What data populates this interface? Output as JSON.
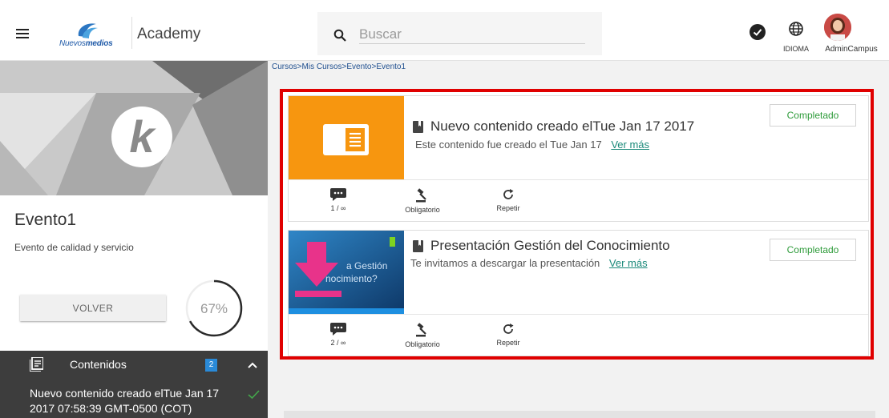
{
  "header": {
    "logo_text_italic": "Nuevos",
    "logo_text_bold": "medios",
    "brand_title": "Academy",
    "search_placeholder": "Buscar",
    "language_label": "IDIOMA",
    "user_label": "AdminCampus"
  },
  "sidebar": {
    "event_title": "Evento1",
    "event_description": "Evento de calidad y servicio",
    "back_button_label": "VOLVER",
    "progress_text": "67%",
    "progress_value": 0.67,
    "contents": {
      "label": "Contenidos",
      "count": "2",
      "items": [
        {
          "label": "Nuevo contenido creado elTue Jan 17 2017 07:58:39 GMT-0500 (COT)"
        }
      ]
    }
  },
  "main": {
    "breadcrumb": "Cursos>Mis Cursos>Evento>Evento1",
    "cards": [
      {
        "title": "Nuevo contenido creado elTue Jan 17 2017",
        "description": "Este contenido fue creado el Tue Jan 17",
        "link_label": "Ver más",
        "status_label": "Completado",
        "counter": "1 / ∞",
        "required_label": "Obligatorio",
        "repeat_label": "Repetir"
      },
      {
        "title": "Presentación Gestión del Conocimiento",
        "description": "Te invitamos a descargar la presentación",
        "link_label": "Ver más",
        "status_label": "Completado",
        "counter": "2 / ∞",
        "required_label": "Obligatorio",
        "repeat_label": "Repetir",
        "thumbnail_text": "a Gestión\nde  nocimiento?"
      }
    ]
  },
  "colors": {
    "accent_orange": "#f7960f",
    "highlight_red": "#e00000",
    "complete_green": "#2e9b3a",
    "link_teal": "#1b8a7a",
    "badge_blue": "#2a8ad8"
  }
}
